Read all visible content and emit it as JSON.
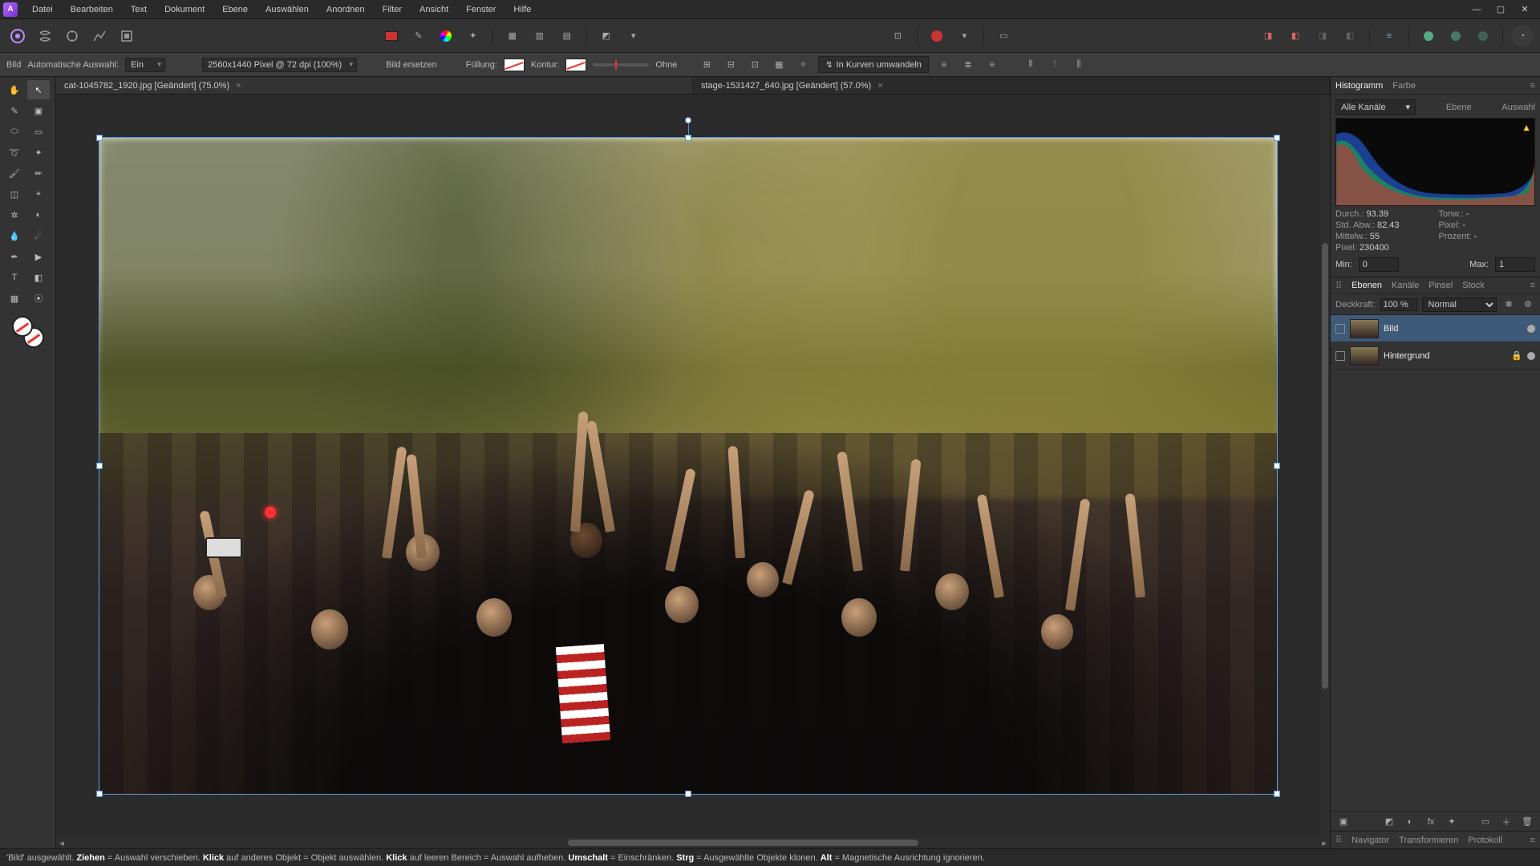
{
  "menu": {
    "items": [
      "Datei",
      "Bearbeiten",
      "Text",
      "Dokument",
      "Ebene",
      "Auswählen",
      "Anordnen",
      "Filter",
      "Ansicht",
      "Fenster",
      "Hilfe"
    ]
  },
  "context": {
    "type_label": "Bild",
    "auto_select_label": "Automatische Auswahl:",
    "auto_select_value": "Ein",
    "size_info": "2560x1440 Pixel @ 72 dpi (100%)",
    "replace": "Bild ersetzen",
    "fill_label": "Füllung:",
    "stroke_label": "Kontur:",
    "stroke_none": "Ohne",
    "curves": "In Kurven umwandeln"
  },
  "tabs": [
    {
      "title": "cat-1045782_1920.jpg [Geändert] (75.0%)"
    },
    {
      "title": "stage-1531427_640.jpg [Geändert] (57.0%)"
    }
  ],
  "histogram": {
    "tab1": "Histogramm",
    "tab2": "Farbe",
    "channels": "Alle Kanäle",
    "btn_layer": "Ebene",
    "btn_sel": "Auswahl",
    "stats": {
      "mean_l": "Durch.:",
      "mean_v": "93.39",
      "tone_l": "Tonw.:",
      "tone_v": "-",
      "std_l": "Std. Abw.:",
      "std_v": "82.43",
      "px_l": "Pixel:",
      "px_v": "-",
      "med_l": "Mittelw.:",
      "med_v": "55",
      "pct_l": "Prozent:",
      "pct_v": "-",
      "count_l": "Pixel:",
      "count_v": "230400"
    },
    "min_l": "Min:",
    "min_v": "0",
    "max_l": "Max:",
    "max_v": "1"
  },
  "layers_panel": {
    "tabs": [
      "Ebenen",
      "Kanäle",
      "Pinsel",
      "Stock"
    ],
    "opacity_l": "Deckkraft:",
    "opacity_v": "100 %",
    "blend": "Normal",
    "layers": [
      {
        "name": "Bild",
        "selected": true
      },
      {
        "name": "Hintergrund",
        "selected": false
      }
    ],
    "nav_tabs": [
      "Navigator",
      "Transformieren",
      "Protokoll"
    ]
  },
  "status": {
    "s1a": "'Bild' ausgewählt. ",
    "s1b": "Ziehen",
    "s1c": " = Auswahl verschieben. ",
    "s2b": "Klick",
    "s2c": " auf anderes Objekt = Objekt auswählen. ",
    "s3b": "Klick",
    "s3c": " auf leeren Bereich = Auswahl aufheben. ",
    "s4b": "Umschalt",
    "s4c": " = Einschränken. ",
    "s5b": "Strg",
    "s5c": " = Ausgewählte Objekte klonen. ",
    "s6b": "Alt",
    "s6c": " = Magnetische Ausrichtung ignorieren."
  }
}
